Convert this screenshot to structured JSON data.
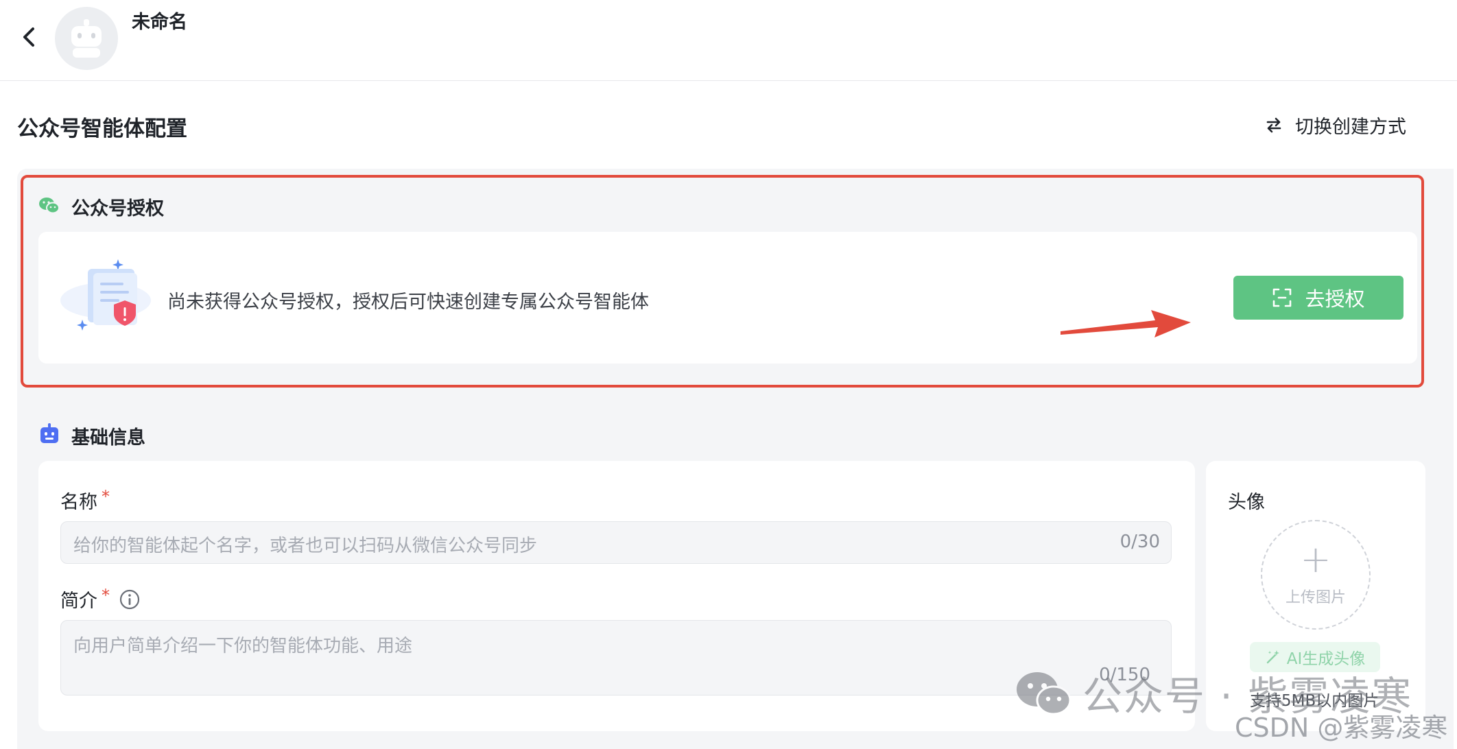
{
  "header": {
    "app_name": "未命名"
  },
  "page": {
    "title": "公众号智能体配置",
    "switch_label": "切换创建方式"
  },
  "auth": {
    "section_title": "公众号授权",
    "message": "尚未获得公众号授权，授权后可快速创建专属公众号智能体",
    "button_label": "去授权"
  },
  "basic": {
    "section_title": "基础信息",
    "name_label": "名称",
    "name_placeholder": "给你的智能体起个名字，或者也可以扫码从微信公众号同步",
    "name_counter": "0/30",
    "intro_label": "简介",
    "intro_placeholder": "向用户简单介绍一下你的智能体功能、用途",
    "intro_counter": "0/150",
    "required_mark": "*"
  },
  "avatar_panel": {
    "label": "头像",
    "upload_label": "上传图片",
    "ai_button_label": "AI生成头像",
    "hint": "支持5MB以内图片"
  },
  "watermark": {
    "line1": "公众号 · 紫雾凌寒",
    "line2": "CSDN @紫雾凌寒"
  },
  "colors": {
    "accent_green": "#5ec483",
    "highlight_red": "#e24a3c",
    "bot_icon_blue": "#4e6ef2"
  }
}
